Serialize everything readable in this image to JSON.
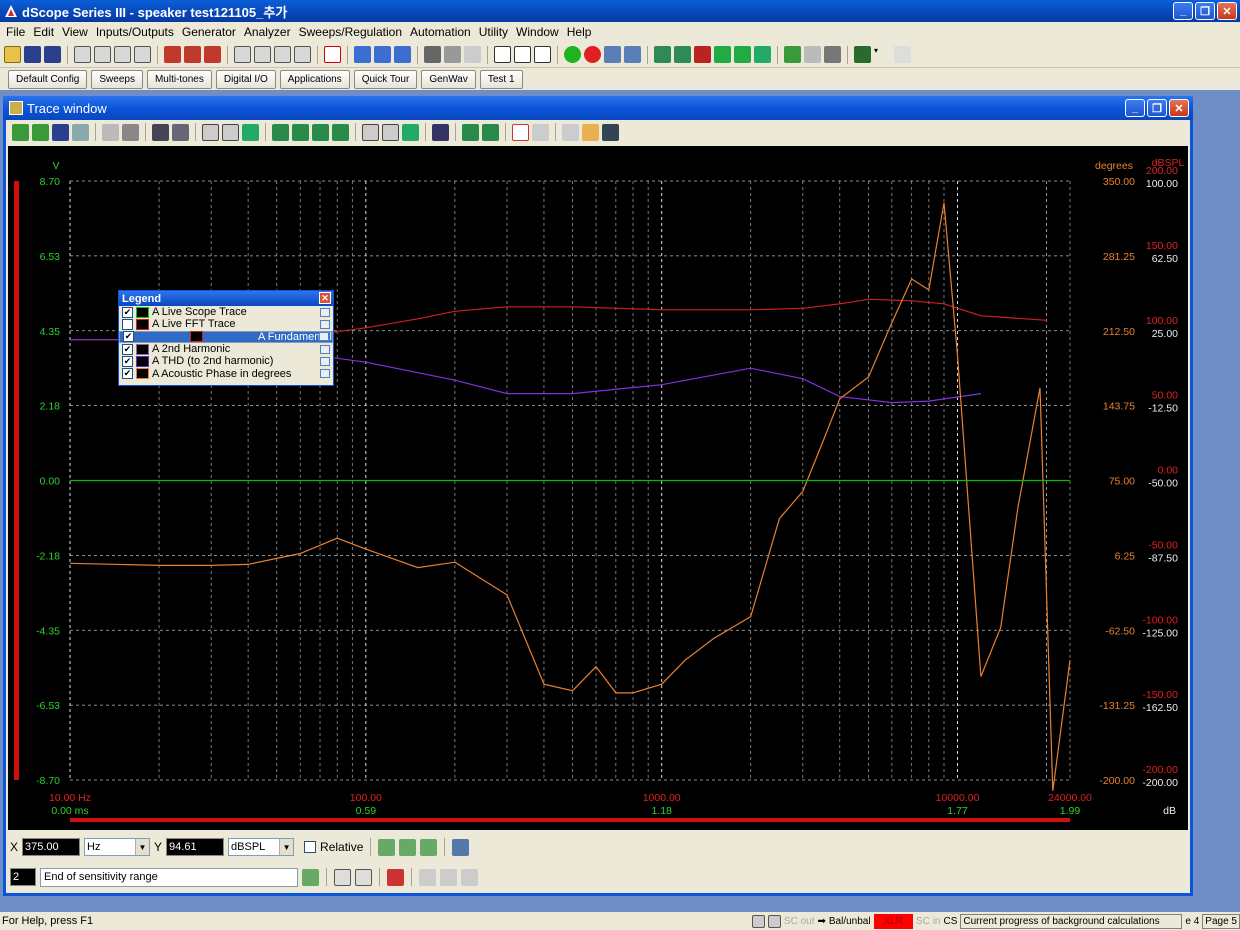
{
  "app": {
    "title": "dScope Series III - speaker test121105_추가"
  },
  "menu": [
    "File",
    "Edit",
    "View",
    "Inputs/Outputs",
    "Generator",
    "Analyzer",
    "Sweeps/Regulation",
    "Automation",
    "Utility",
    "Window",
    "Help"
  ],
  "quick_buttons": [
    "Default Config",
    "Sweeps",
    "Multi-tones",
    "Digital I/O",
    "Applications",
    "Quick Tour",
    "GenWav",
    "Test 1"
  ],
  "trace_window": {
    "title": "Trace window"
  },
  "legend": {
    "title": "Legend",
    "items": [
      {
        "label": "A Live Scope Trace",
        "checked": true,
        "color": "#00c000"
      },
      {
        "label": "A Live FFT Trace",
        "checked": false,
        "color": "#d02020"
      },
      {
        "label": "A Fundamental",
        "checked": true,
        "color": "#d02020",
        "selected": true
      },
      {
        "label": "A 2nd Harmonic",
        "checked": true,
        "color": "#8030e0"
      },
      {
        "label": "A THD (to 2nd harmonic)",
        "checked": true,
        "color": "#6a20c0"
      },
      {
        "label": "A Acoustic Phase in degrees",
        "checked": true,
        "color": "#e88030"
      }
    ]
  },
  "chart_data": {
    "type": "line",
    "xscale": "log",
    "xlim": [
      10,
      24000
    ],
    "x_ticks": [
      "10.00 Hz",
      "100.00",
      "1000.00",
      "10000.00",
      "24000.00"
    ],
    "x2_ticks": [
      "0.00 ms",
      "0.59",
      "1.18",
      "1.77",
      "1.99"
    ],
    "x2_unit": "dB",
    "left_axis": {
      "unit": "V",
      "ticks": [
        "8.70",
        "6.53",
        "4.35",
        "2.18",
        "0.00",
        "-2.18",
        "-4.35",
        "-6.53",
        "-8.70"
      ]
    },
    "right_axis_degrees": {
      "unit": "degrees",
      "ticks": [
        "350.00",
        "281.25",
        "212.50",
        "143.75",
        "75.00",
        "6.25",
        "-62.50",
        "-131.25",
        "-200.00"
      ]
    },
    "right_axis_dbspl_red": {
      "unit": "dBSPL",
      "ticks": [
        "200.00",
        "150.00",
        "100.00",
        "50.00",
        "0.00",
        "-50.00",
        "-100.00",
        "-150.00",
        "-200.00"
      ]
    },
    "right_axis_dbspl_white": {
      "ticks": [
        "100.00",
        "62.50",
        "25.00",
        "-12.50",
        "-50.00",
        "-87.50",
        "-125.00",
        "-162.50",
        "-200.00"
      ]
    },
    "series": [
      {
        "name": "A Fundamental",
        "color": "#d02020",
        "x": [
          10,
          30,
          40,
          60,
          100,
          150,
          200,
          300,
          500,
          1000,
          2000,
          3000,
          4000,
          5000,
          7000,
          9000,
          12000,
          20000
        ],
        "y": [
          94,
          94,
          94,
          96,
          102,
          108,
          113,
          116,
          116,
          114,
          114,
          115,
          118,
          121,
          120,
          118,
          110,
          107
        ]
      },
      {
        "name": "A 2nd Harmonic",
        "color": "#8030e0",
        "x": [
          10,
          30,
          50,
          100,
          200,
          300,
          500,
          1000,
          2000,
          3000,
          4000,
          6000,
          8000,
          12000
        ],
        "y": [
          94,
          94,
          87,
          79,
          67,
          58,
          58,
          64,
          75,
          68,
          56,
          52,
          53,
          58
        ]
      },
      {
        "name": "A Acoustic Phase in degrees",
        "color": "#e88030",
        "x": [
          10,
          20,
          30,
          40,
          60,
          80,
          100,
          150,
          200,
          300,
          400,
          500,
          600,
          700,
          800,
          1000,
          1200,
          1500,
          2000,
          2500,
          3000,
          3500,
          4000,
          5000,
          6000,
          7000,
          8000,
          9000,
          10000,
          12000,
          14000,
          16000,
          19000,
          21000,
          24000
        ],
        "y": [
          -1,
          -3,
          -3,
          -2,
          8,
          22,
          12,
          -5,
          0,
          -30,
          -112,
          -118,
          -96,
          -120,
          -120,
          -112,
          -90,
          -70,
          -50,
          40,
          65,
          110,
          150,
          170,
          220,
          260,
          250,
          330,
          190,
          -105,
          -60,
          50,
          160,
          -210,
          -90
        ]
      },
      {
        "name": "A Live Scope Trace",
        "color": "#00c000",
        "x": [
          10,
          24000
        ],
        "y": [
          0,
          0
        ]
      }
    ]
  },
  "cursor": {
    "x_label": "X",
    "x_value": "375.00",
    "x_unit": "Hz",
    "y_label": "Y",
    "y_value": "94.61",
    "y_unit": "dBSPL",
    "relative_label": "Relative"
  },
  "info": {
    "index": "2",
    "message": "End of sensitivity range"
  },
  "status": {
    "help": "For Help, press F1",
    "sc_out": "SC out",
    "balunbal": "Bal/unbal",
    "xlr": "XLR",
    "sc_in": "SC in",
    "cs": "CS",
    "progress": "Current progress of background calculations",
    "page4": "e 4",
    "page5": "Page 5"
  }
}
